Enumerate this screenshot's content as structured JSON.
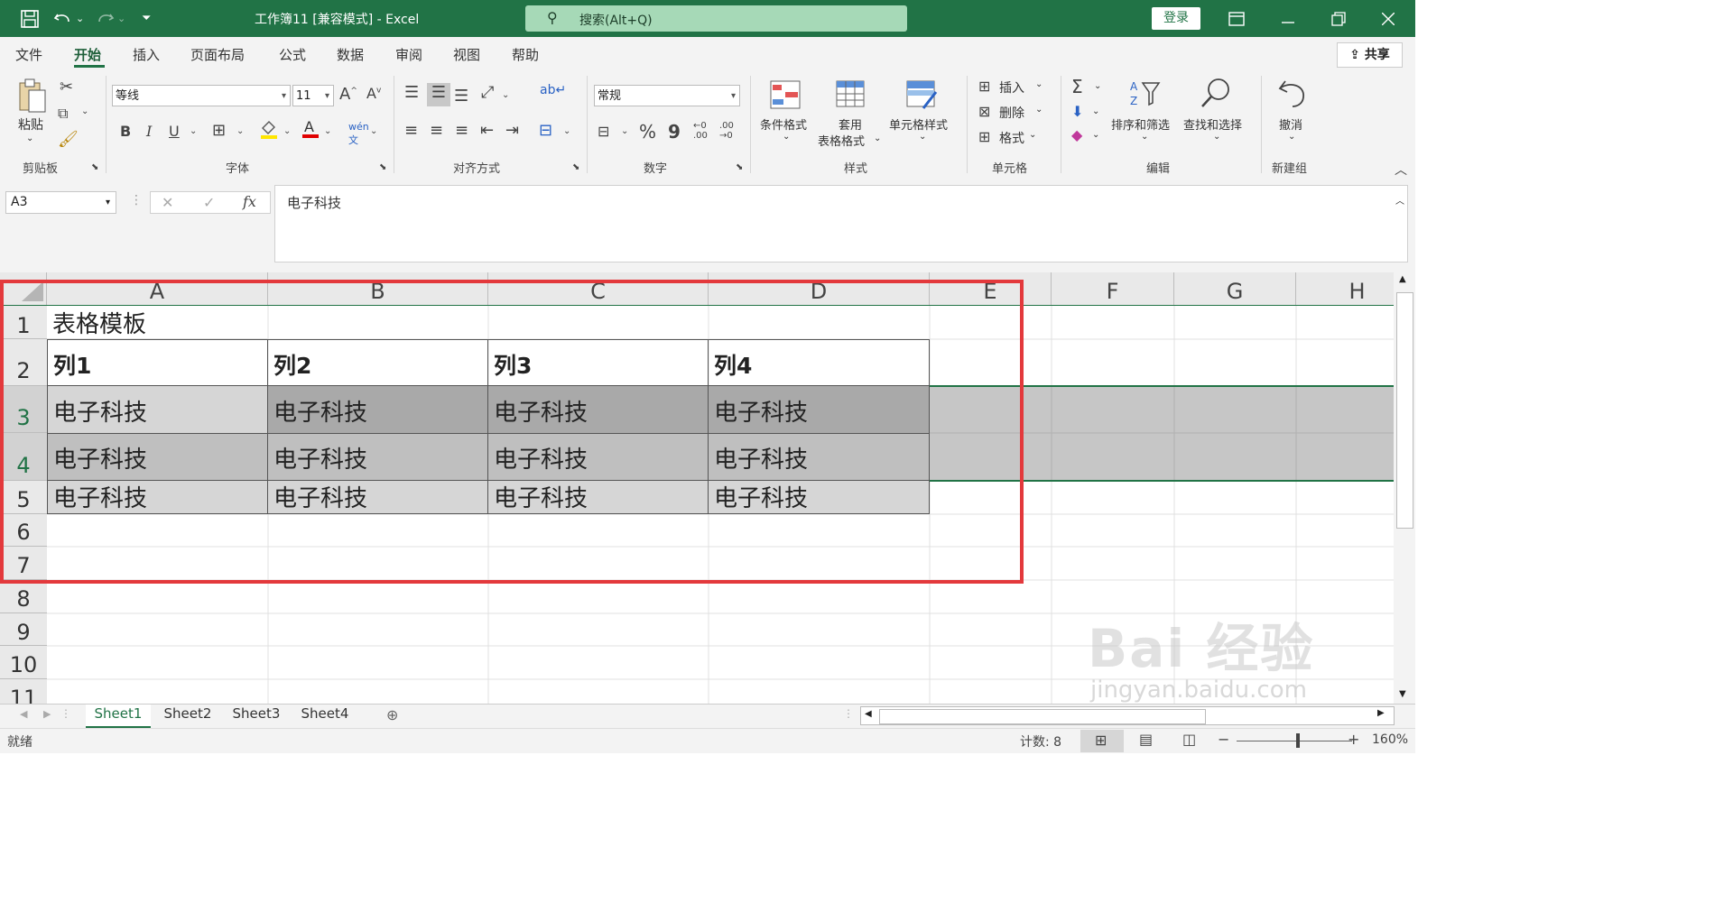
{
  "titlebar": {
    "title": "工作簿11  [兼容模式]  -  Excel",
    "search_placeholder": "搜索(Alt+Q)",
    "login": "登录"
  },
  "menu": {
    "items": [
      "文件",
      "开始",
      "插入",
      "页面布局",
      "公式",
      "数据",
      "审阅",
      "视图",
      "帮助"
    ],
    "active": "开始",
    "share": "共享"
  },
  "ribbon": {
    "clipboard": {
      "paste": "粘贴",
      "group": "剪贴板"
    },
    "font": {
      "name": "等线",
      "size": "11",
      "group": "字体",
      "bold": "B",
      "italic": "I",
      "underline": "U"
    },
    "alignment": {
      "group": "对齐方式"
    },
    "number": {
      "format": "常规",
      "group": "数字",
      "percent": "%",
      "comma": "9"
    },
    "styles": {
      "conditional": "条件格式",
      "table_a": "套用",
      "table_b": "表格格式",
      "cell_styles": "单元格样式",
      "group": "样式"
    },
    "cells": {
      "insert": "插入",
      "delete": "删除",
      "format": "格式",
      "group": "单元格"
    },
    "editing": {
      "sort": "排序和筛选",
      "find": "查找和选择",
      "group": "编辑"
    },
    "undo": {
      "label": "撤消",
      "group": "新建组"
    }
  },
  "formula_bar": {
    "name_box": "A3",
    "fx": "fx",
    "content": "电子科技"
  },
  "grid": {
    "columns": [
      "A",
      "B",
      "C",
      "D",
      "E",
      "F",
      "G",
      "H"
    ],
    "rows": [
      "1",
      "2",
      "3",
      "4",
      "5",
      "6",
      "7",
      "8",
      "9",
      "10",
      "11"
    ],
    "cells": {
      "A1": "表格模板",
      "A2": "列1",
      "B2": "列2",
      "C2": "列3",
      "D2": "列4",
      "A3": "电子科技",
      "B3": "电子科技",
      "C3": "电子科技",
      "D3": "电子科技",
      "A4": "电子科技",
      "B4": "电子科技",
      "C4": "电子科技",
      "D4": "电子科技",
      "A5": "电子科技",
      "B5": "电子科技",
      "C5": "电子科技",
      "D5": "电子科技"
    }
  },
  "sheets": [
    "Sheet1",
    "Sheet2",
    "Sheet3",
    "Sheet4"
  ],
  "active_sheet": "Sheet1",
  "status": {
    "ready": "就绪",
    "count": "计数: 8",
    "zoom": "160%"
  },
  "watermark": {
    "line1": "Bai  经验",
    "line2": "jingyan.baidu.com"
  },
  "colors": {
    "excel_green": "#217346",
    "red_highlight": "#e3393c",
    "shade_light": "#d6d6d6",
    "shade_mid": "#bfbfbf",
    "shade_dark": "#a6a6a6"
  }
}
